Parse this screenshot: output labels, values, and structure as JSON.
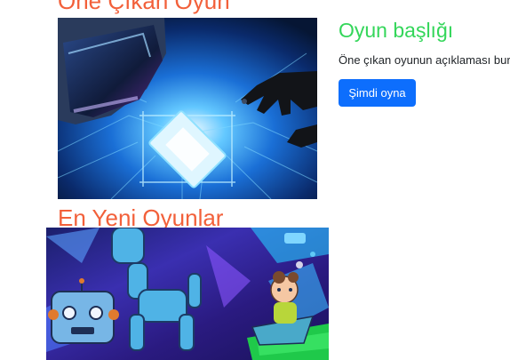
{
  "featured": {
    "heading": "Öne Çıkan Oyun",
    "image_alt": "VR headset, robotic hand and glowing circuit chip artwork",
    "game_title": "Oyun başlığı",
    "description": "Öne çıkan oyunun açıklaması burada",
    "play_button": "Şimdi oyna"
  },
  "latest": {
    "heading": "En Yeni Oyunlar",
    "image_alt": "Painted artwork of robots and a character in a colorful space scene"
  },
  "colors": {
    "heading": "#f2603a",
    "game_title": "#34d65a",
    "button": "#0d6efd"
  }
}
